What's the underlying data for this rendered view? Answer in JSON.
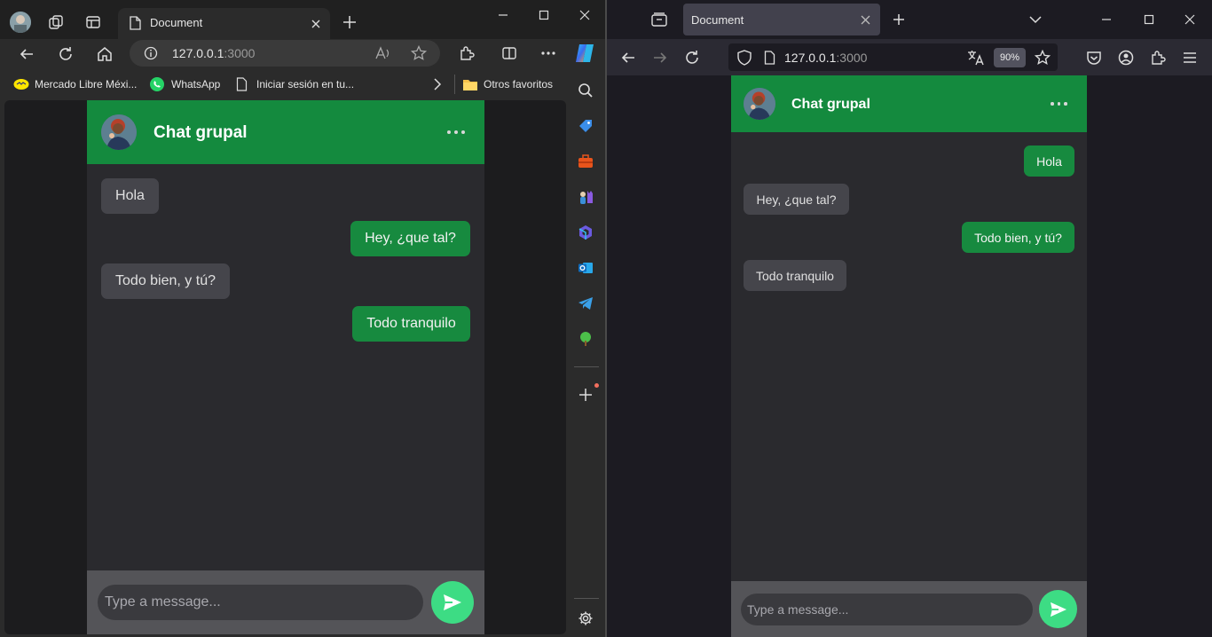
{
  "edge": {
    "tab_title": "Document",
    "url_host": "127.0.0.1",
    "url_port": ":3000",
    "bookmarks": [
      {
        "label": "Mercado Libre Méxi...",
        "icon": "mercadolibre-icon"
      },
      {
        "label": "WhatsApp",
        "icon": "whatsapp-icon"
      },
      {
        "label": "Iniciar sesión en tu...",
        "icon": "page-icon"
      }
    ],
    "other_favorites": "Otros favoritos"
  },
  "firefox": {
    "tab_title": "Document",
    "url_host": "127.0.0.1",
    "url_port": ":3000",
    "zoom": "90%"
  },
  "chat": {
    "title": "Chat grupal",
    "placeholder": "Type a message...",
    "colors": {
      "header": "#148a3e",
      "outgoing": "#178a3f",
      "incoming": "#45454b",
      "send": "#3ddc84"
    }
  },
  "edge_messages": [
    {
      "text": "Hola",
      "direction": "incoming"
    },
    {
      "text": "Hey, ¿que tal?",
      "direction": "outgoing"
    },
    {
      "text": "Todo bien, y tú?",
      "direction": "incoming"
    },
    {
      "text": "Todo tranquilo",
      "direction": "outgoing"
    }
  ],
  "firefox_messages": [
    {
      "text": "Hola",
      "direction": "outgoing"
    },
    {
      "text": "Hey, ¿que tal?",
      "direction": "incoming"
    },
    {
      "text": "Todo bien, y tú?",
      "direction": "outgoing"
    },
    {
      "text": "Todo tranquilo",
      "direction": "incoming"
    }
  ]
}
